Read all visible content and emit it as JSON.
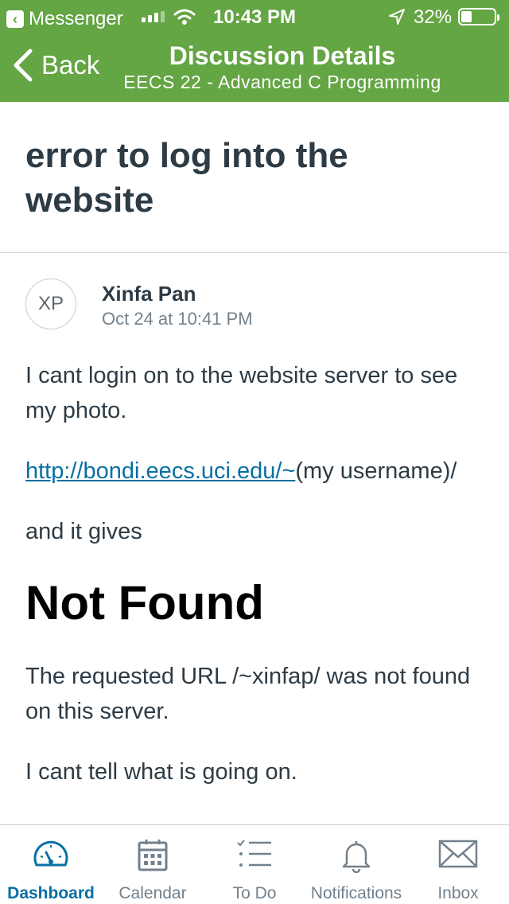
{
  "status_bar": {
    "back_app": "Messenger",
    "time": "10:43 PM",
    "battery": "32%",
    "battery_level": 0.32
  },
  "nav": {
    "back_label": "Back",
    "title": "Discussion Details",
    "subtitle": "EECS 22 - Advanced C Programming"
  },
  "discussion": {
    "title": "error to log into the website",
    "author": {
      "initials": "XP",
      "name": "Xinfa Pan",
      "date": "Oct 24 at 10:41 PM"
    },
    "body": {
      "p1": "I cant login on to the website server to see my photo.",
      "link": "http://bondi.eecs.uci.edu/~",
      "link_suffix": "(my username)/",
      "p3": "and it gives",
      "heading": "Not Found",
      "p4": "The requested URL /~xinfap/ was not found on this server.",
      "p5": "I cant tell what is going on."
    }
  },
  "tabbar": {
    "colors": {
      "active": "#0770a3",
      "inactive": "#73818c"
    },
    "items": [
      {
        "label": "Dashboard",
        "icon": "dashboard-icon",
        "active": true
      },
      {
        "label": "Calendar",
        "icon": "calendar-icon",
        "active": false
      },
      {
        "label": "To Do",
        "icon": "todo-icon",
        "active": false
      },
      {
        "label": "Notifications",
        "icon": "bell-icon",
        "active": false
      },
      {
        "label": "Inbox",
        "icon": "mail-icon",
        "active": false
      }
    ]
  },
  "colors": {
    "header_green": "#64a544",
    "link": "#0770a3",
    "text": "#2d3b45"
  }
}
